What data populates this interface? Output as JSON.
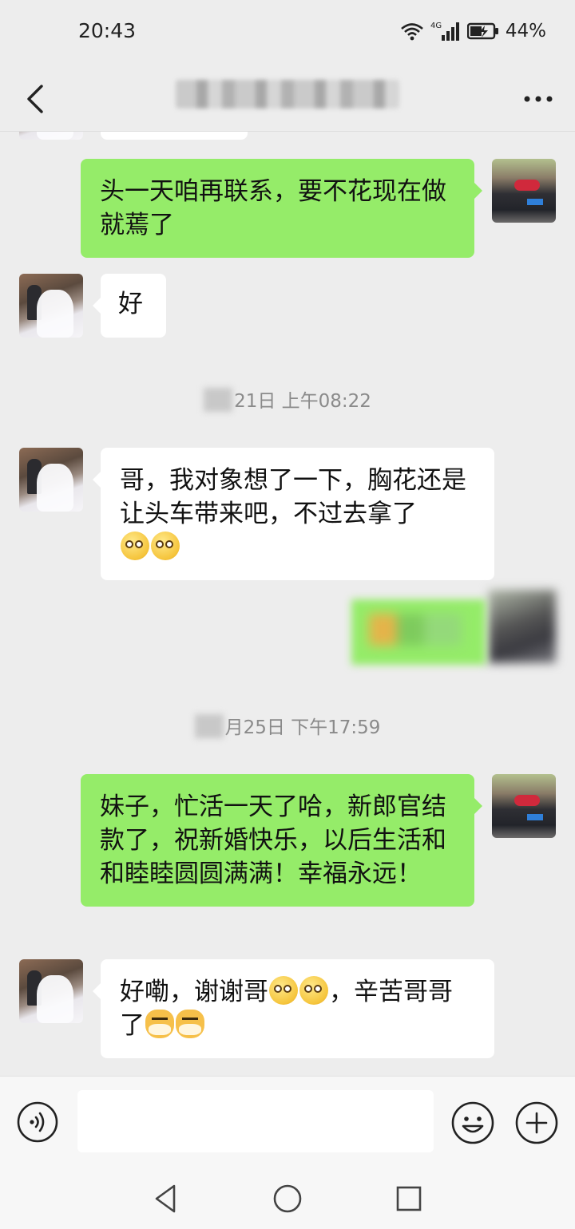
{
  "status_bar": {
    "time": "20:43",
    "network_label": "4G",
    "battery": "44%"
  },
  "header": {
    "back_icon": "chevron-left-icon",
    "title_redacted": true,
    "more_icon": "more-dots-icon"
  },
  "messages": [
    {
      "side": "out",
      "text": "头一天咱再联系，要不花现在做就蔫了"
    },
    {
      "side": "in",
      "text": "好"
    },
    {
      "timestamp": "21日 上午08:22"
    },
    {
      "side": "in",
      "text": "哥，我对象想了一下，胸花还是让头车带来吧，不过去拿了",
      "emojis": [
        "doge",
        "doge"
      ]
    },
    {
      "side": "out",
      "redacted": true
    },
    {
      "timestamp": "月25日 下午17:59"
    },
    {
      "side": "out",
      "text": "妹子，忙活一天了哈，新郎官结款了，祝新婚快乐，以后生活和和睦睦圆圆满满！幸福永远！"
    },
    {
      "side": "in",
      "text_before": "好嘞，谢谢哥",
      "text_middle": "，辛苦哥哥了",
      "emojis": [
        "doge",
        "doge",
        "cat",
        "cat"
      ]
    }
  ],
  "input_bar": {
    "voice_icon": "voice-icon",
    "placeholder": "",
    "emoji_icon": "emoji-icon",
    "plus_icon": "plus-icon"
  },
  "system_nav": {
    "back_icon": "triangle-back-icon",
    "home_icon": "circle-home-icon",
    "recents_icon": "square-recents-icon"
  },
  "colors": {
    "background": "#ededed",
    "bubble_out": "#95ec69",
    "bubble_in": "#ffffff"
  }
}
